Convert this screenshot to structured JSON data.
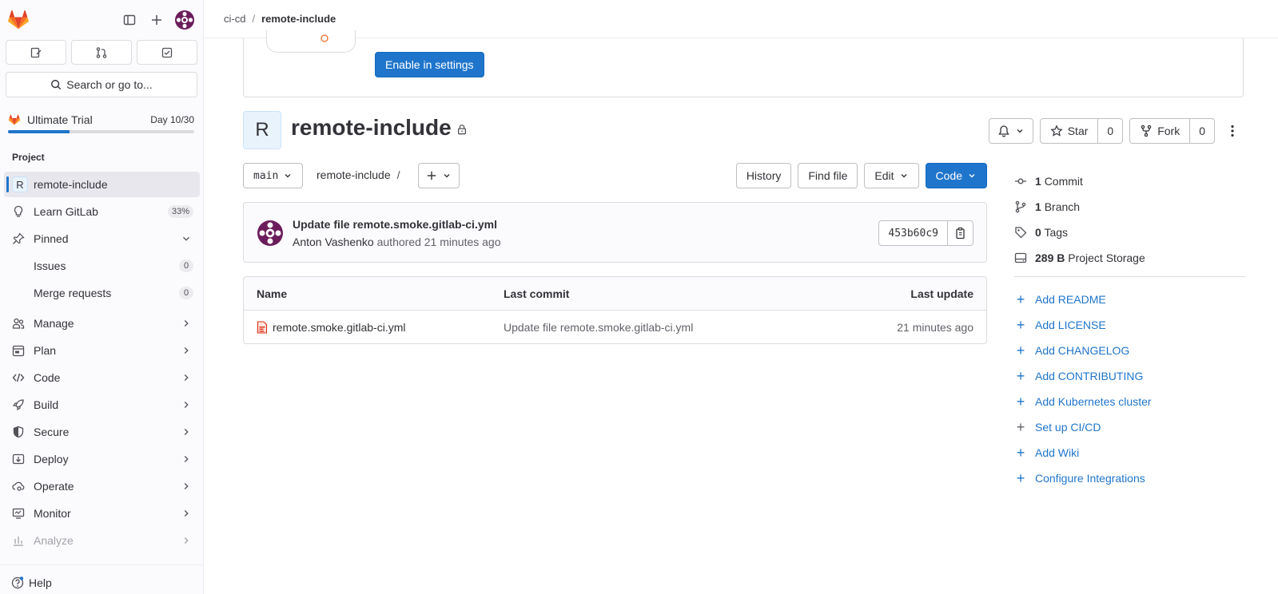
{
  "sidebar": {
    "search_label": "Search or go to...",
    "trial": {
      "title": "Ultimate Trial",
      "day": "Day 10/30",
      "progress": 0.33
    },
    "section_label": "Project",
    "items": [
      {
        "label": "remote-include",
        "letter": "R",
        "active": true
      },
      {
        "label": "Learn GitLab",
        "badge": "33%"
      },
      {
        "label": "Pinned"
      },
      {
        "label": "Issues",
        "badge": "0"
      },
      {
        "label": "Merge requests",
        "badge": "0"
      },
      {
        "label": "Manage"
      },
      {
        "label": "Plan"
      },
      {
        "label": "Code"
      },
      {
        "label": "Build"
      },
      {
        "label": "Secure"
      },
      {
        "label": "Deploy"
      },
      {
        "label": "Operate"
      },
      {
        "label": "Monitor"
      },
      {
        "label": "Analyze"
      }
    ],
    "help_label": "Help"
  },
  "breadcrumb": {
    "parent": "ci-cd",
    "separator": "/",
    "current": "remote-include"
  },
  "banner": {
    "button_label": "Enable in settings"
  },
  "project": {
    "avatar_letter": "R",
    "title": "remote-include",
    "star_label": "Star",
    "star_count": "0",
    "fork_label": "Fork",
    "fork_count": "0"
  },
  "toolbar": {
    "branch": "main",
    "path": "remote-include",
    "path_sep": "/",
    "history": "History",
    "find_file": "Find file",
    "edit": "Edit",
    "code": "Code"
  },
  "commit": {
    "title": "Update file remote.smoke.gitlab-ci.yml",
    "author": "Anton Vashenko",
    "meta": " authored 21 minutes ago",
    "sha": "453b60c9"
  },
  "files": {
    "headers": [
      "Name",
      "Last commit",
      "Last update"
    ],
    "rows": [
      {
        "name": "remote.smoke.gitlab-ci.yml",
        "last_commit": "Update file remote.smoke.gitlab-ci.yml",
        "last_update": "21 minutes ago"
      }
    ]
  },
  "side": {
    "stats": [
      {
        "count": "1",
        "label": "Commit"
      },
      {
        "count": "1",
        "label": "Branch"
      },
      {
        "count": "0",
        "label": "Tags"
      },
      {
        "count": "289 B",
        "label": "Project Storage"
      }
    ],
    "links": [
      "Add README",
      "Add LICENSE",
      "Add CHANGELOG",
      "Add CONTRIBUTING",
      "Add Kubernetes cluster",
      "Set up CI/CD",
      "Add Wiki",
      "Configure Integrations"
    ]
  },
  "colors": {
    "accent": "#1f75cb",
    "brand_orange": "#e24329",
    "avatar_purple": "#6b1d5b"
  }
}
